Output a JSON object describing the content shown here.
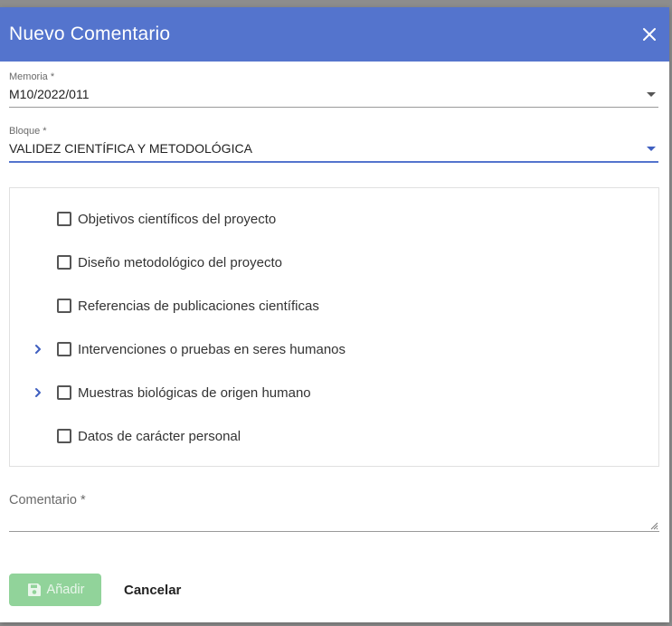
{
  "dialog": {
    "title": "Nuevo Comentario",
    "close_icon": "close-icon"
  },
  "memoria": {
    "label": "Memoria *",
    "value": "M10/2022/011"
  },
  "bloque": {
    "label": "Bloque *",
    "value": "VALIDEZ CIENTÍFICA Y METODOLÓGICA"
  },
  "tree": {
    "items": [
      {
        "label": "Objetivos científicos del proyecto",
        "expandable": false,
        "checked": false
      },
      {
        "label": "Diseño metodológico del proyecto",
        "expandable": false,
        "checked": false
      },
      {
        "label": "Referencias de publicaciones científicas",
        "expandable": false,
        "checked": false
      },
      {
        "label": "Intervenciones o pruebas en seres humanos",
        "expandable": true,
        "checked": false
      },
      {
        "label": "Muestras biológicas de origen humano",
        "expandable": true,
        "checked": false
      },
      {
        "label": "Datos de carácter personal",
        "expandable": false,
        "checked": false
      }
    ]
  },
  "comentario": {
    "label": "Comentario *",
    "value": ""
  },
  "footer": {
    "add_label": "Añadir",
    "cancel_label": "Cancelar"
  },
  "colors": {
    "header": "#5474cd",
    "accent": "#3f5fc0",
    "add_button_disabled": "#91d39a"
  }
}
